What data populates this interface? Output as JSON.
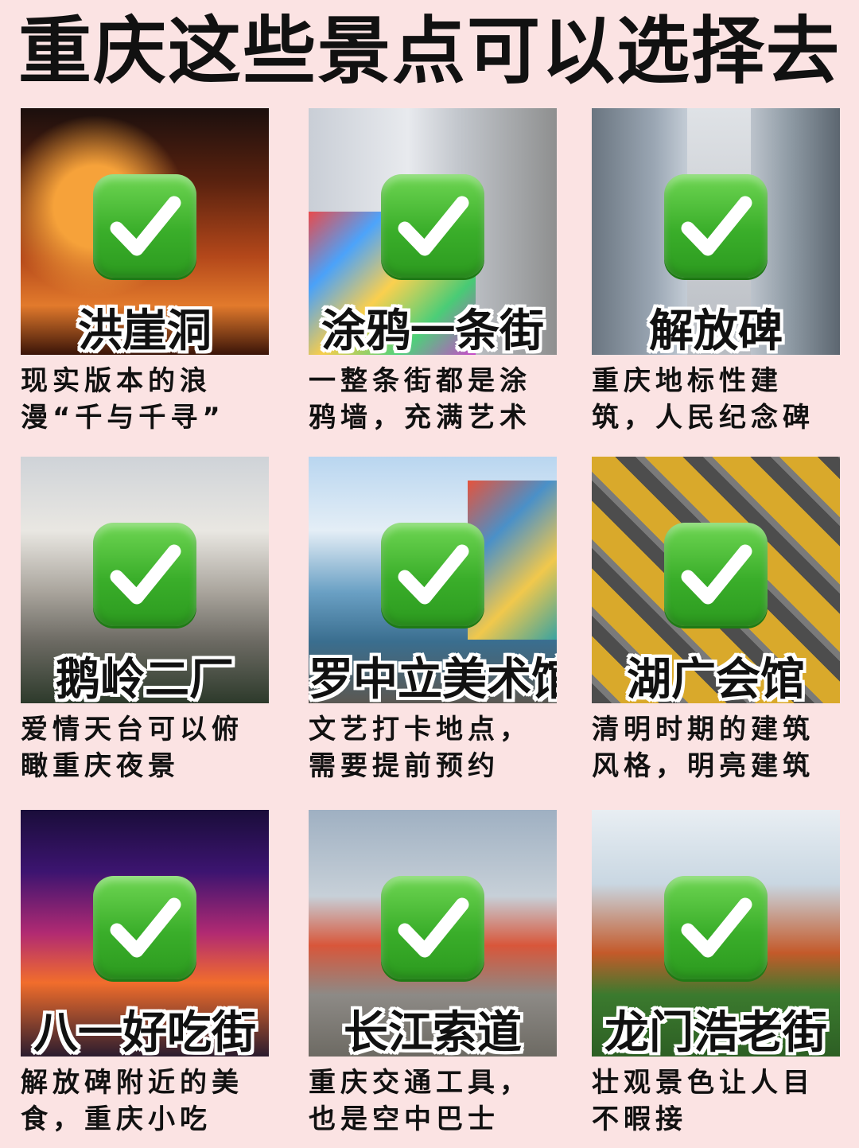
{
  "title": "重庆这些景点可以选择去",
  "check_icon_color": "#3aae2a",
  "spots": [
    {
      "name": "洪崖洞",
      "desc": [
        "现实版本的浪",
        "漫“千与千寻”"
      ]
    },
    {
      "name": "涂鸦一条街",
      "desc": [
        "一整条街都是涂",
        "鸦墙，充满艺术"
      ]
    },
    {
      "name": "解放碑",
      "desc": [
        "重庆地标性建",
        "筑，人民纪念碑"
      ]
    },
    {
      "name": "鹅岭二厂",
      "desc": [
        "爱情天台可以俯",
        "瞰重庆夜景"
      ]
    },
    {
      "name": "罗中立美术馆",
      "desc": [
        "文艺打卡地点，",
        "需要提前预约"
      ]
    },
    {
      "name": "湖广会馆",
      "desc": [
        "清明时期的建筑",
        "风格，明亮建筑"
      ]
    },
    {
      "name": "八一好吃街",
      "desc": [
        "解放碑附近的美",
        "食，重庆小吃"
      ]
    },
    {
      "name": "长江索道",
      "desc": [
        "重庆交通工具，",
        "也是空中巴士"
      ]
    },
    {
      "name": "龙门浩老街",
      "desc": [
        "壮观景色让人目",
        "不暇接"
      ]
    }
  ]
}
